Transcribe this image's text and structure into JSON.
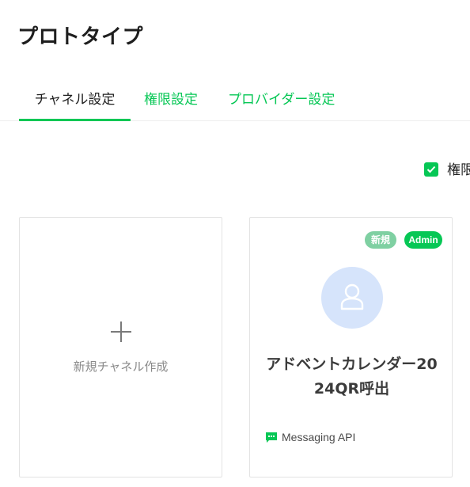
{
  "page": {
    "title": "プロトタイプ"
  },
  "tabs": [
    {
      "label": "チャネル設定",
      "active": true
    },
    {
      "label": "権限設定",
      "active": false
    },
    {
      "label": "プロバイダー設定",
      "active": false
    }
  ],
  "permission_toggle": {
    "label": "権限",
    "checked": true
  },
  "new_channel_card": {
    "icon": "plus-icon",
    "label": "新規チャネル作成"
  },
  "channels": [
    {
      "badges": [
        "新規",
        "Admin"
      ],
      "avatar_icon": "user-icon",
      "name": "アドベントカレンダー2024QR呼出",
      "api_type": "Messaging API"
    }
  ],
  "colors": {
    "accent": "#06c755",
    "badge_new": "#7fd0a2",
    "avatar_bg": "#d6e4fb"
  }
}
